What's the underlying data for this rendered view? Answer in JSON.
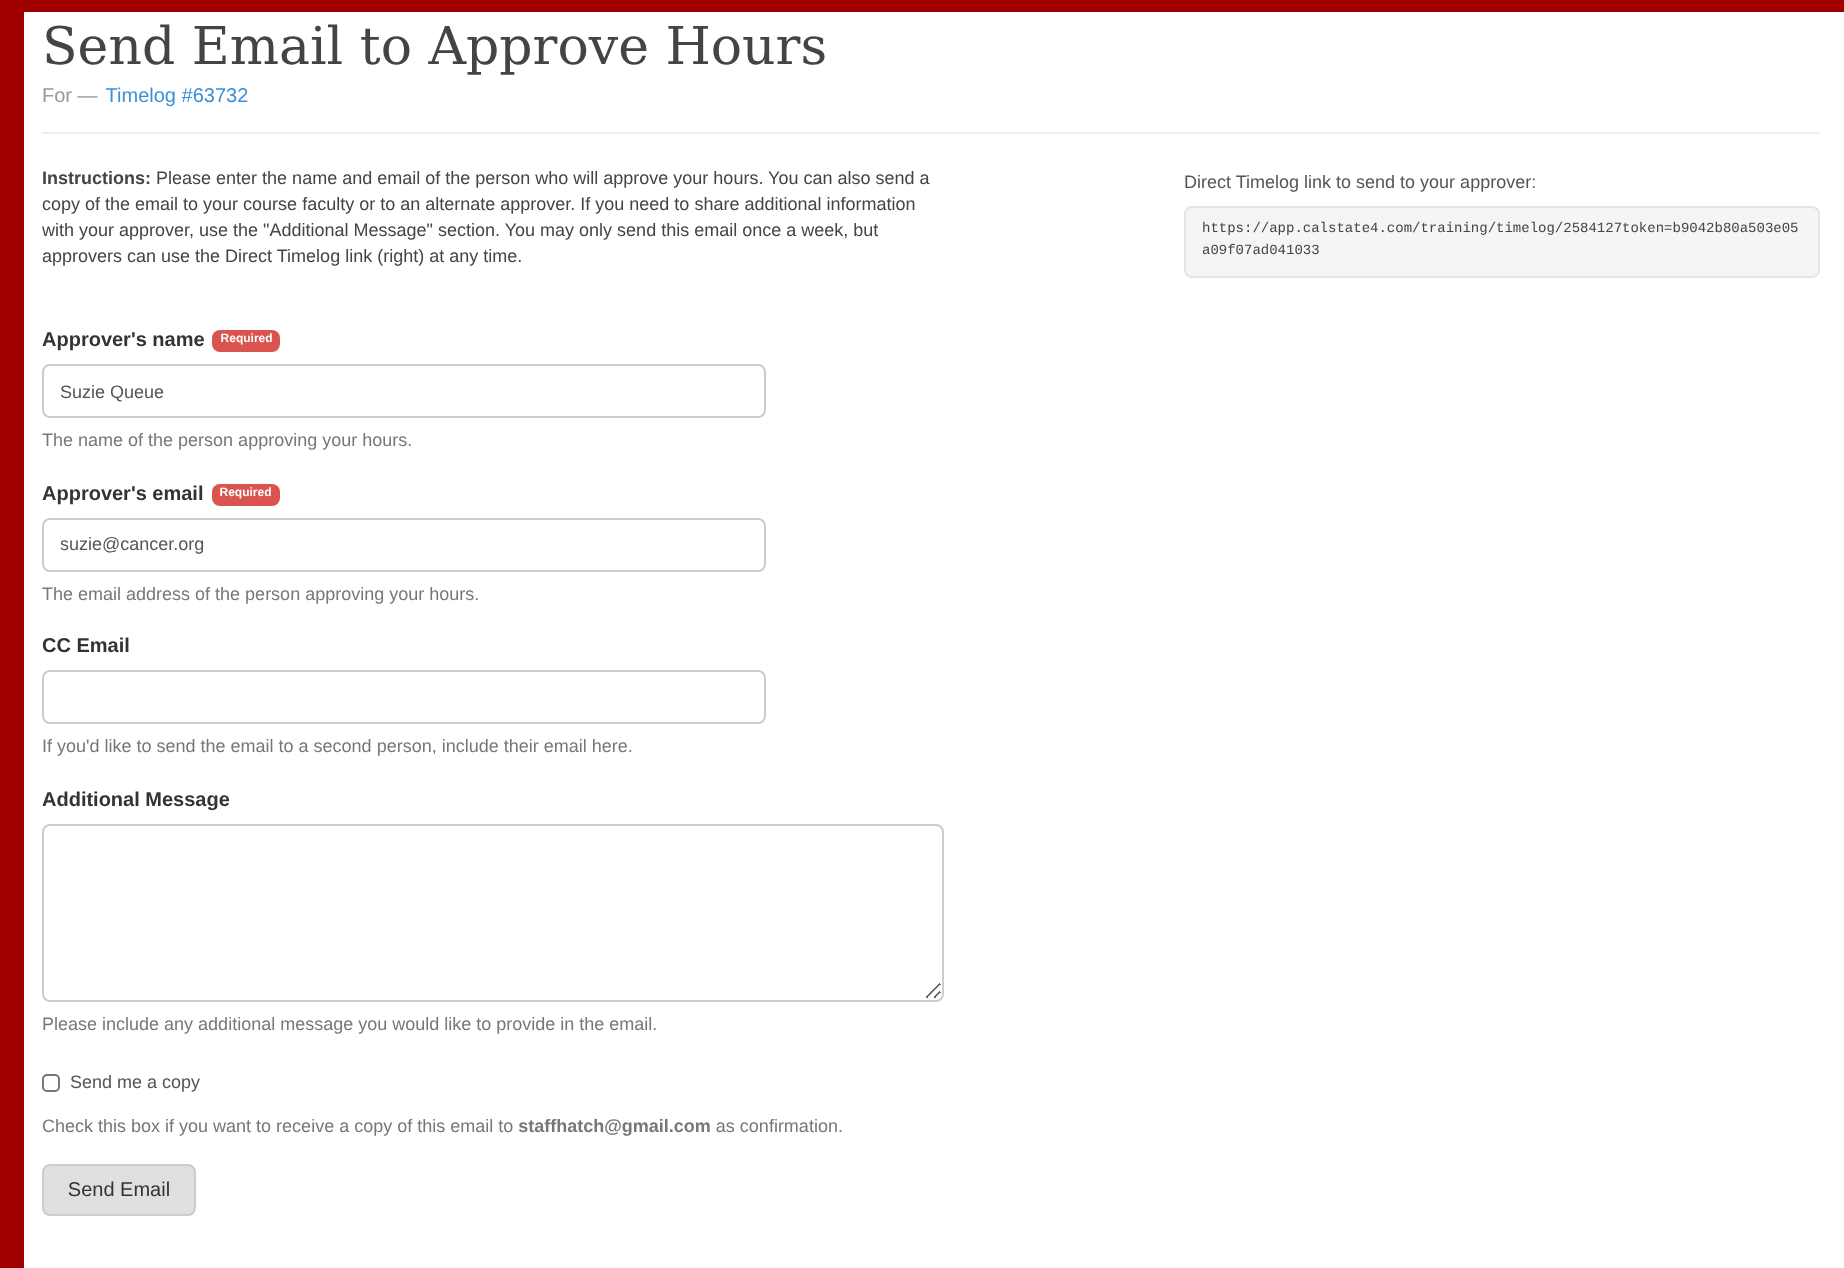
{
  "title": "Send Email to Approve Hours",
  "subtitle": {
    "prefix": "For —",
    "link": "Timelog #63732"
  },
  "instructions": "**Instructions:** Please enter the name and email of the person who will approve your hours. You can also send a copy of the email to your course faculty or to an alternate approver. If you need to share additional information with your approver, use the \"Additional Message\" section. You may only send this email once a week, but approvers can use the Direct Timelog link (right) at any time.",
  "direct_link": {
    "label": "Direct Timelog link to send to your approver:",
    "url": "https://app.calstate4.com/training/timelog/2584127token=b9042b80a503e05a09f07ad041033"
  },
  "fields": [
    {
      "kind": "input",
      "label": "Approver's name",
      "badge": "Required",
      "value": "Suzie Queue",
      "help": "The name of the person approving your hours."
    },
    {
      "kind": "input",
      "label": "Approver's email",
      "badge": "Required",
      "value": "suzie@cancer.org",
      "help": "The email address of the person approving your hours."
    },
    {
      "kind": "input",
      "label": "CC Email",
      "help": "If you'd like to send the email to a second person, include their email here."
    },
    {
      "kind": "textarea",
      "label": "Additional Message",
      "help": "Please include any additional message you would like to provide in the email."
    }
  ],
  "send_copy": {
    "label": "Send me a copy",
    "checked": false,
    "help": "Check this box if you want to receive a copy of this email to **staffhatch@gmail.com** as confirmation."
  },
  "buttons": [
    "Send Email"
  ]
}
